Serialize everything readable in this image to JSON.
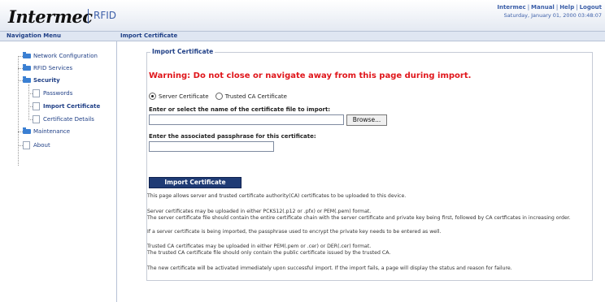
{
  "header": {
    "brand": "Intermec",
    "product": "RFID",
    "links": [
      "Intermec",
      "Manual",
      "Help",
      "Logout"
    ],
    "datetime": "Saturday, January 01, 2000 03:48:07"
  },
  "navbar": {
    "nav_title": "Navigation Menu",
    "page_title": "Import Certificate"
  },
  "sidebar": {
    "items": [
      {
        "label": "Network Configuration",
        "type": "folder"
      },
      {
        "label": "RFID Services",
        "type": "folder"
      },
      {
        "label": "Security",
        "type": "folder"
      },
      {
        "label": "Passwords",
        "type": "page"
      },
      {
        "label": "Import Certificate",
        "type": "page"
      },
      {
        "label": "Certificate Details",
        "type": "page"
      },
      {
        "label": "Maintenance",
        "type": "folder"
      },
      {
        "label": "About",
        "type": "page"
      }
    ]
  },
  "main": {
    "legend": "Import Certificate",
    "warning": "Warning: Do not close or navigate away from this page during import.",
    "radio_server": "Server Certificate",
    "radio_trusted": "Trusted CA Certificate",
    "selected_radio": "Server Certificate",
    "file_label": "Enter or select the name of the certificate file to import:",
    "file_value": "",
    "browse_label": "Browse...",
    "pass_label": "Enter the associated passphrase for this certificate:",
    "pass_value": "",
    "submit_label": "Import Certificate",
    "info_1": "This page allows server and trusted certificate authority(CA) certificates to be uploaded to this device.",
    "info_2a": "Server certificates may be uploaded in either PCKS12(.p12 or .pfx) or PEM(.pem) format.",
    "info_2b": "The server certificate file should contain the entire certificate chain with the server certificate and private key being first, followed by CA certficates in increasing order.",
    "info_2c": "If a server certificate is being imported, the passphrase used to encrypt the private key needs to be entered as well.",
    "info_3a": "Trusted CA certificates may be uploaded in either PEM(.pem or .cer) or DER(.cer) format.",
    "info_3b": "The trusted CA certificate file should only contain the public certificate issued by the trusted CA.",
    "info_4": "The new certificate will be activated immediately upon successful import. If the import fails, a page will display the status and reason for failure."
  },
  "colors": {
    "brand_blue": "#3b5ea8",
    "nav_text": "#1f3f86",
    "warning_red": "#e0161b",
    "button_bg": "#1f3b75"
  }
}
